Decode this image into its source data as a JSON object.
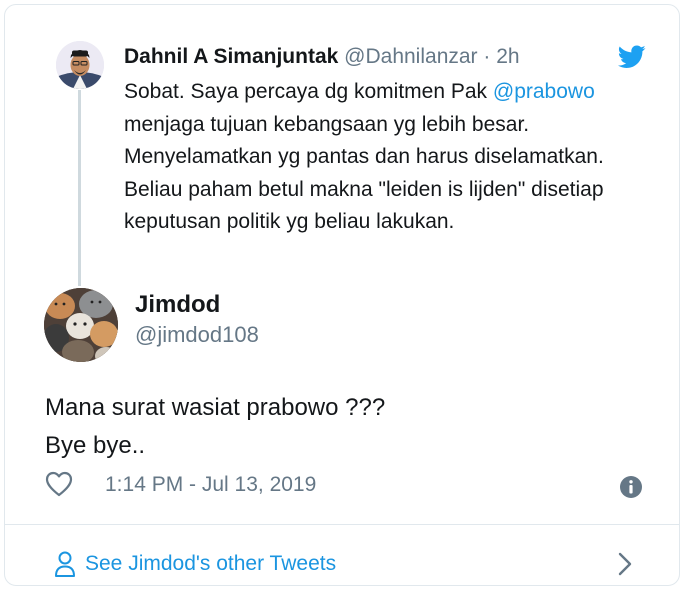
{
  "parent_tweet": {
    "author_name": "Dahnil A Simanjuntak",
    "author_handle": "@Dahnilanzar",
    "separator": "·",
    "age": "2h",
    "text_before_mention": "Sobat. Saya percaya dg komitmen Pak ",
    "mention": "@prabowo",
    "text_after_mention": " menjaga tujuan kebangsaan yg lebih besar. Menyelamatkan yg pantas dan harus diselamatkan. Beliau paham betul makna \"leiden is lijden\" disetiap keputusan politik yg beliau lakukan."
  },
  "tweet": {
    "author_name": "Jimdod",
    "author_handle": "@jimdod108",
    "text_lines": [
      "Mana surat wasiat prabowo ???",
      "Bye bye.."
    ],
    "timestamp": "1:14 PM - Jul 13, 2019"
  },
  "footer": {
    "link_label": "See Jimdod's other Tweets"
  },
  "colors": {
    "link_blue": "#1b95e0",
    "twitter_blue": "#1da1f2",
    "secondary_text": "#657786",
    "border": "#e1e8ed"
  },
  "icons": {
    "brand": "twitter-bird-icon",
    "like": "heart-outline-icon",
    "info": "info-circle-icon",
    "profile": "person-icon",
    "chevron": "chevron-right-icon"
  }
}
